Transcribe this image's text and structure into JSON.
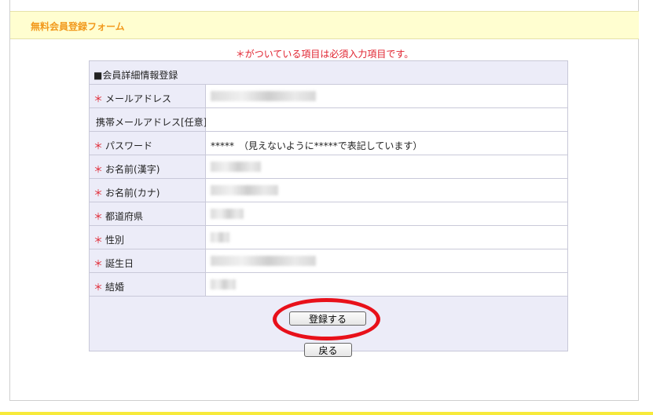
{
  "header": {
    "title": "無料会員登録フォーム"
  },
  "required_note": "＊がついている項目は必須入力項目です。",
  "form": {
    "section_title": "■会員詳細情報登録",
    "rows": [
      {
        "label": "メールアドレス",
        "required": "＊",
        "value": ""
      },
      {
        "label": "携帯メールアドレス[任意]",
        "required": "",
        "value": ""
      },
      {
        "label": "パスワード",
        "required": "＊",
        "value": "*****　（見えないように*****で表記しています）"
      },
      {
        "label": "お名前(漢字)",
        "required": "＊",
        "value": ""
      },
      {
        "label": "お名前(カナ)",
        "required": "＊",
        "value": ""
      },
      {
        "label": "都道府県",
        "required": "＊",
        "value": ""
      },
      {
        "label": "性別",
        "required": "＊",
        "value": ""
      },
      {
        "label": "誕生日",
        "required": "＊",
        "value": ""
      },
      {
        "label": "結婚",
        "required": "＊",
        "value": ""
      }
    ]
  },
  "buttons": {
    "submit": "登録する",
    "back": "戻る"
  },
  "colors": {
    "accent": "#f29a1e",
    "required": "#e0232f",
    "highlight": "#e8101a"
  }
}
